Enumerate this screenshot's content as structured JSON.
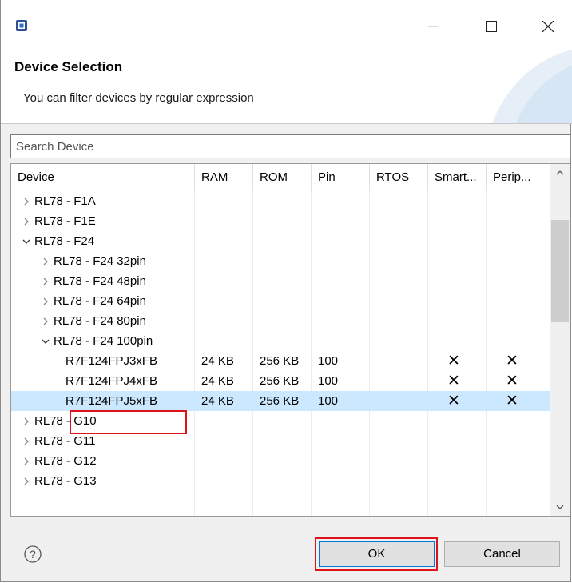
{
  "header": {
    "title": "Device Selection",
    "description": "You can filter devices by regular expression"
  },
  "search": {
    "placeholder": "Search Device",
    "value": ""
  },
  "table": {
    "columns": [
      "Device",
      "RAM",
      "ROM",
      "Pin",
      "RTOS",
      "Smart...",
      "Perip..."
    ],
    "rows": [
      {
        "label": "RL78 - F1A",
        "level": 0,
        "toggle": "collapsed"
      },
      {
        "label": "RL78 - F1E",
        "level": 0,
        "toggle": "collapsed"
      },
      {
        "label": "RL78 - F24",
        "level": 0,
        "toggle": "expanded"
      },
      {
        "label": "RL78 - F24 32pin",
        "level": 1,
        "toggle": "collapsed"
      },
      {
        "label": "RL78 - F24 48pin",
        "level": 1,
        "toggle": "collapsed"
      },
      {
        "label": "RL78 - F24 64pin",
        "level": 1,
        "toggle": "collapsed"
      },
      {
        "label": "RL78 - F24 80pin",
        "level": 1,
        "toggle": "collapsed"
      },
      {
        "label": "RL78 - F24 100pin",
        "level": 1,
        "toggle": "expanded"
      },
      {
        "label": "R7F124FPJ3xFB",
        "level": 2,
        "toggle": "none",
        "ram": "24 KB",
        "rom": "256 KB",
        "pin": "100",
        "rtos": "",
        "smart": "✕",
        "perip": "✕"
      },
      {
        "label": "R7F124FPJ4xFB",
        "level": 2,
        "toggle": "none",
        "ram": "24 KB",
        "rom": "256 KB",
        "pin": "100",
        "rtos": "",
        "smart": "✕",
        "perip": "✕"
      },
      {
        "label": "R7F124FPJ5xFB",
        "level": 2,
        "toggle": "none",
        "ram": "24 KB",
        "rom": "256 KB",
        "pin": "100",
        "rtos": "",
        "smart": "✕",
        "perip": "✕",
        "selected": true
      },
      {
        "label": "RL78 - G10",
        "level": 0,
        "toggle": "collapsed"
      },
      {
        "label": "RL78 - G11",
        "level": 0,
        "toggle": "collapsed"
      },
      {
        "label": "RL78 - G12",
        "level": 0,
        "toggle": "collapsed"
      },
      {
        "label": "RL78 - G13",
        "level": 0,
        "toggle": "collapsed"
      }
    ]
  },
  "buttons": {
    "ok": "OK",
    "cancel": "Cancel"
  },
  "colors": {
    "highlight": "#e0111b",
    "selection": "#cce8ff",
    "accent": "#0078d7"
  },
  "icons": {
    "app": "chip-icon",
    "minimize": "minimize-icon",
    "maximize": "maximize-icon",
    "close": "close-icon",
    "help": "help-icon"
  }
}
